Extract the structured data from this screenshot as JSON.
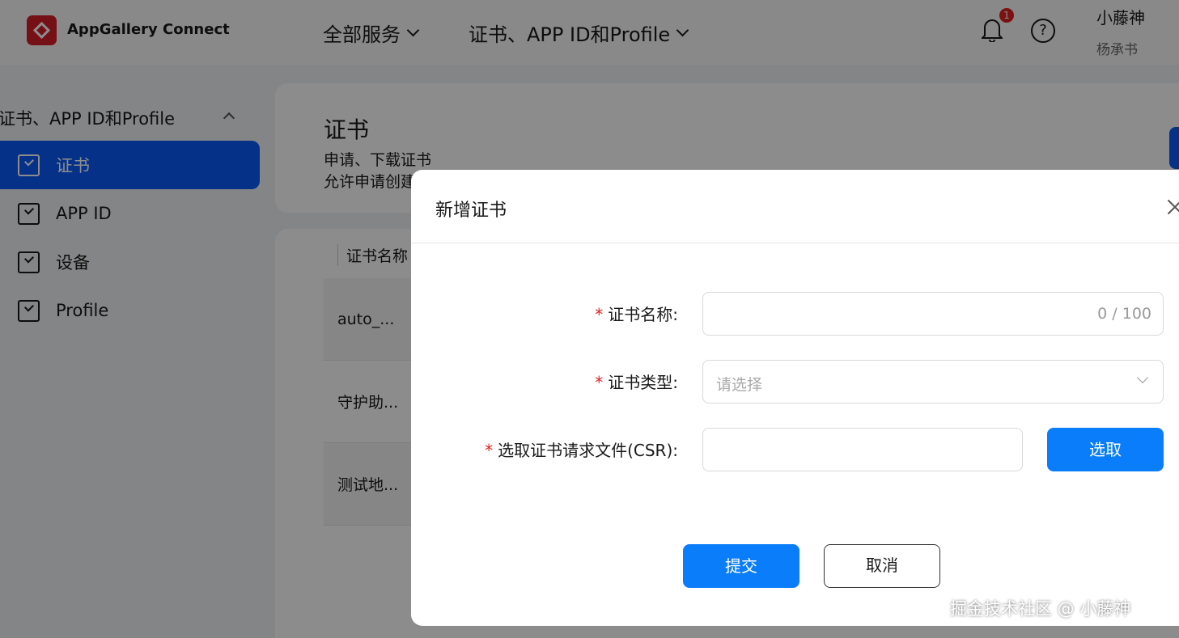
{
  "header": {
    "brand": "AppGallery Connect",
    "nav_all_services": "全部服务",
    "nav_cert": "证书、APP ID和Profile",
    "notification_count": "1",
    "help_symbol": "?",
    "user_name": "小藤神",
    "user_sub": "杨承书",
    "accent": "#0a59f7"
  },
  "sidebar": {
    "group_label": "证书、APP ID和Profile",
    "items": [
      {
        "label": "证书",
        "active": true
      },
      {
        "label": "APP ID",
        "active": false
      },
      {
        "label": "设备",
        "active": false
      },
      {
        "label": "Profile",
        "active": false
      }
    ]
  },
  "main": {
    "title": "证书",
    "desc_line1": "申请、下载证书",
    "desc_line2": "允许申请创建",
    "table_header": "证书名称",
    "rows": [
      "auto_...",
      "守护助...",
      "测试地..."
    ]
  },
  "modal": {
    "title": "新增证书",
    "required_mark": "*",
    "name_label": "证书名称:",
    "name_counter": "0 / 100",
    "type_label": "证书类型:",
    "type_placeholder": "请选择",
    "csr_label": "选取证书请求文件(CSR):",
    "pick_button": "选取",
    "submit_button": "提交",
    "cancel_button": "取消"
  },
  "watermark": "掘金技术社区 @ 小藤神"
}
